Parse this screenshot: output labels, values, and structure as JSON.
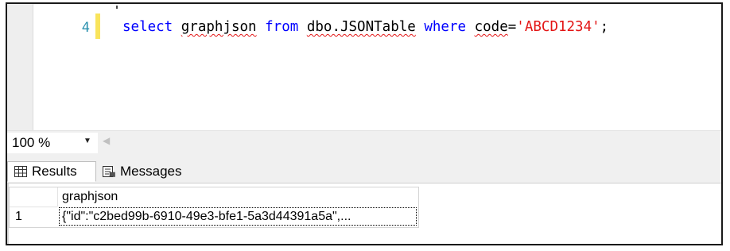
{
  "editor": {
    "line_number": "4",
    "code": {
      "kw_select": "select",
      "col": "graphjson",
      "kw_from": "from",
      "table": "dbo.JSONTable",
      "kw_where": "where",
      "field": "code",
      "eq": "=",
      "value": "'ABCD1234'",
      "semicolon": ";"
    },
    "colors": {
      "keyword": "#0000ff",
      "string": "#e31515",
      "line_number": "#2b91af",
      "change_marker": "#f9e45c"
    }
  },
  "zoom": {
    "value": "100 %"
  },
  "tabs": [
    {
      "label": "Results",
      "icon": "grid-icon",
      "active": true
    },
    {
      "label": "Messages",
      "icon": "messages-icon",
      "active": false
    }
  ],
  "results": {
    "columns": [
      "graphjson"
    ],
    "rows": [
      {
        "row_number": "1",
        "cells": [
          "{\"id\":\"c2bed99b-6910-49e3-bfe1-5a3d44391a5a\",..."
        ]
      }
    ]
  }
}
